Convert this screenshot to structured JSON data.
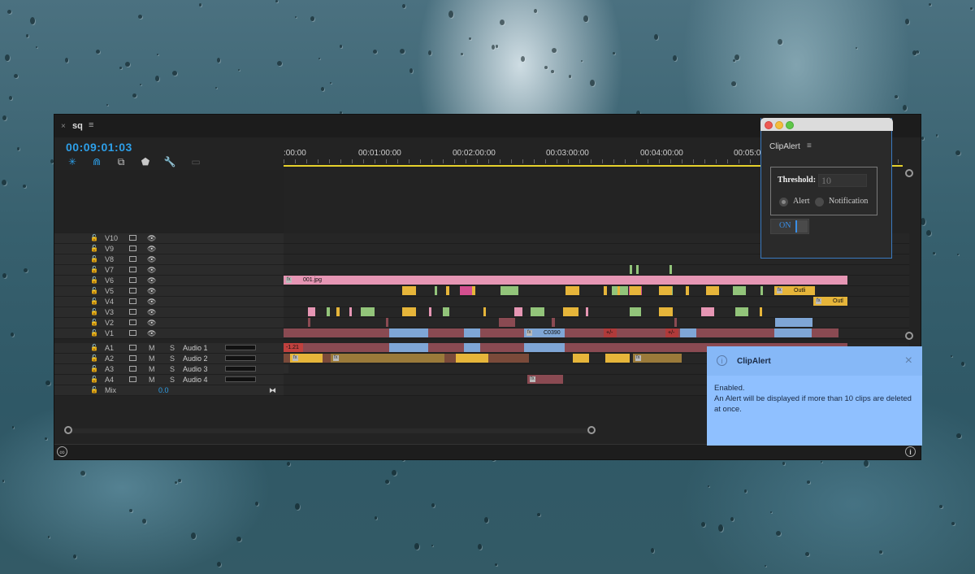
{
  "panel": {
    "tab_close": "×",
    "tab_name": "sq",
    "tab_menu": "≡",
    "timecode": "00:09:01:03",
    "ruler_labels": [
      ":00:00",
      "00:01:00:00",
      "00:02:00:00",
      "00:03:00:00",
      "00:04:00:00",
      "00:05:00"
    ],
    "video_tracks": [
      "V10",
      "V9",
      "V8",
      "V7",
      "V6",
      "V5",
      "V4",
      "V3",
      "V2",
      "V1"
    ],
    "audio_tracks": [
      {
        "id": "A1",
        "m": "M",
        "s": "S",
        "name": "Audio 1"
      },
      {
        "id": "A2",
        "m": "M",
        "s": "S",
        "name": "Audio 2"
      },
      {
        "id": "A3",
        "m": "M",
        "s": "S",
        "name": "Audio 3"
      },
      {
        "id": "A4",
        "m": "M",
        "s": "S",
        "name": "Audio 4"
      }
    ],
    "mix": {
      "label": "Mix",
      "value": "0.0"
    },
    "clip_labels": {
      "v6_image": "001.jpg",
      "v1_c0390": "C0390",
      "v5_outline": "Outli",
      "v4_outline": "Outl",
      "v1_marker1": "+/-",
      "v1_marker2": "+/-",
      "a1_badge": "-1.21"
    },
    "tools": [
      "ripple-icon",
      "magnet-icon",
      "linked-icon",
      "marker-icon",
      "wrench-icon",
      "captions-icon"
    ]
  },
  "clipalert_panel": {
    "title": "ClipAlert",
    "menu": "≡",
    "threshold_label": "Threshold:",
    "threshold_value": "10",
    "option_alert": "Alert",
    "option_notification": "Notification",
    "selected_option": "Alert",
    "toggle_label": "ON"
  },
  "notification": {
    "title": "ClipAlert",
    "close": "×",
    "body_line1": "Enabled.",
    "body_line2": "An Alert will be displayed if more than 10 clips are deleted at once."
  },
  "colors": {
    "timecode_blue": "#2d9fe8",
    "workarea_yellow": "#e6d12c",
    "clip_pink": "#e696b4",
    "clip_green": "#92c47a",
    "clip_gold": "#e6b53a",
    "clip_maroon": "#8a4a52",
    "clip_blue": "#7fa6d6",
    "notification_bg": "#8fc0ff"
  }
}
